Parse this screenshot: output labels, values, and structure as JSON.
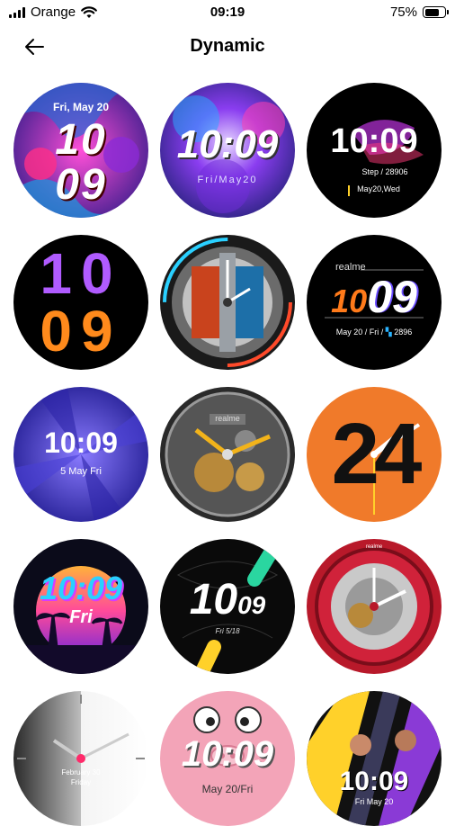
{
  "status_bar": {
    "carrier": "Orange",
    "time": "09:19",
    "battery_percent": "75%",
    "battery_level": 0.75,
    "icons": [
      "signal-icon",
      "wifi-icon",
      "battery-icon"
    ]
  },
  "header": {
    "title": "Dynamic",
    "back_icon": "back-arrow-icon"
  },
  "watch_faces": [
    {
      "id": "face-1",
      "texts": {
        "date": "Fri, May 20",
        "hour": "10",
        "min": "09"
      }
    },
    {
      "id": "face-2",
      "texts": {
        "time": "10:09",
        "date": "Fri/May20"
      }
    },
    {
      "id": "face-3",
      "texts": {
        "time": "10:09",
        "step": "Step / 28906",
        "date": "May20,Wed"
      }
    },
    {
      "id": "face-4",
      "texts": {
        "hour": "10",
        "min": "09"
      }
    },
    {
      "id": "face-5",
      "texts": {}
    },
    {
      "id": "face-6",
      "texts": {
        "brand": "realme",
        "hour": "10",
        "min": "09",
        "info": "May 20  /  Fri  /",
        "steps": "2896"
      }
    },
    {
      "id": "face-7",
      "texts": {
        "time": "10:09",
        "date": "5 May Fri"
      }
    },
    {
      "id": "face-8",
      "texts": {
        "brand": "realme"
      }
    },
    {
      "id": "face-9",
      "texts": {
        "digits": "24"
      }
    },
    {
      "id": "face-10",
      "texts": {
        "time": "10:09",
        "day": "Fri"
      }
    },
    {
      "id": "face-11",
      "texts": {
        "hour": "10",
        "min": "09",
        "date": "Fri 5/18"
      }
    },
    {
      "id": "face-12",
      "texts": {
        "brand": "realme"
      }
    },
    {
      "id": "face-13",
      "texts": {
        "date": "February 30",
        "day": "Friday"
      }
    },
    {
      "id": "face-14",
      "texts": {
        "time": "10:09",
        "date": "May 20/Fri"
      }
    },
    {
      "id": "face-15",
      "texts": {
        "time": "10:09",
        "date": "Fri  May 20"
      }
    }
  ]
}
